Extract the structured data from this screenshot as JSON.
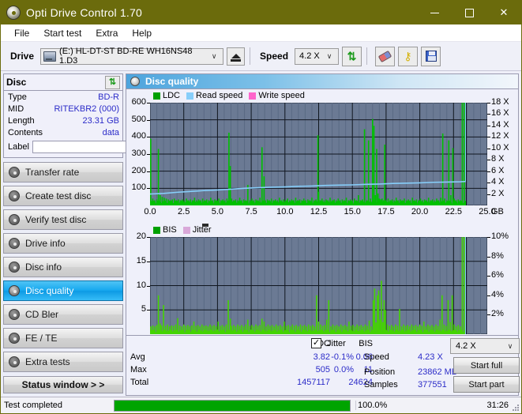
{
  "window": {
    "title": "Opti Drive Control 1.70",
    "icon": "disc-icon",
    "titlebar_color": "#6b6b0c",
    "minimize_label": "–",
    "maximize_label": "□",
    "close_label": "✕"
  },
  "menu": {
    "items": [
      "File",
      "Start test",
      "Extra",
      "Help"
    ]
  },
  "toolbar": {
    "drive_label": "Drive",
    "drive_value": "(E:)  HL-DT-ST BD-RE  WH16NS48 1.D3",
    "eject_icon": "eject-icon",
    "speed_label": "Speed",
    "speed_value": "4.2 X",
    "refresh_icon": "refresh-icon",
    "erase_icon": "eraser-icon",
    "key_icon": "key-icon",
    "save_icon": "save-icon",
    "dropdown_arrow": "∨"
  },
  "sidebar": {
    "disc_panel": {
      "title": "Disc",
      "refresh_icon": "refresh-icon",
      "rows": [
        {
          "key": "Type",
          "value": "BD-R"
        },
        {
          "key": "MID",
          "value": "RITEKBR2 (000)"
        },
        {
          "key": "Length",
          "value": "23.31 GB"
        },
        {
          "key": "Contents",
          "value": "data"
        }
      ],
      "label_key": "Label",
      "label_value": "",
      "label_placeholder": "",
      "disc_button_icon": "disc-icon"
    },
    "nav": [
      {
        "label": "Transfer rate",
        "active": false
      },
      {
        "label": "Create test disc",
        "active": false
      },
      {
        "label": "Verify test disc",
        "active": false
      },
      {
        "label": "Drive info",
        "active": false
      },
      {
        "label": "Disc info",
        "active": false
      },
      {
        "label": "Disc quality",
        "active": true
      },
      {
        "label": "CD Bler",
        "active": false
      },
      {
        "label": "FE / TE",
        "active": false
      },
      {
        "label": "Extra tests",
        "active": false
      }
    ],
    "status_window_label": "Status window > >"
  },
  "main": {
    "header_title": "Disc quality",
    "header_icon": "disc-quality-icon"
  },
  "stats": {
    "col_ldc": "LDC",
    "col_bis": "BIS",
    "row_avg": "Avg",
    "row_max": "Max",
    "row_total": "Total",
    "ldc_avg": "3.82",
    "ldc_max": "505",
    "ldc_total": "1457117",
    "bis_avg": "0.06",
    "bis_max": "11",
    "bis_total": "24624",
    "jitter_label": "Jitter",
    "jitter_checked": "✓",
    "jitter_avg": "-0.1%",
    "jitter_max": "0.0%",
    "speed_label": "Speed",
    "speed_value": "4.23 X",
    "position_label": "Position",
    "position_value": "23862 MB",
    "samples_label": "Samples",
    "samples_value": "377551",
    "speed_select": "4.2 X",
    "start_full_label": "Start full",
    "start_part_label": "Start part"
  },
  "statusbar": {
    "message": "Test completed",
    "progress_percent": "100.0%",
    "progress_value": 100,
    "elapsed": "31:26"
  },
  "chart_data": [
    {
      "id": "ldc-chart",
      "type": "line",
      "title": "",
      "xlabel": "GB",
      "ylabel": "",
      "xlim": [
        0,
        25
      ],
      "ylim": [
        0,
        600
      ],
      "y2lim": [
        0,
        18
      ],
      "grid": true,
      "legend_position": "top-left",
      "legend": [
        {
          "name": "LDC",
          "color": "#00a000"
        },
        {
          "name": "Read speed",
          "color": "#87cefa"
        },
        {
          "name": "Write speed",
          "color": "#ff66cc"
        }
      ],
      "xticks": [
        "0.0",
        "2.5",
        "5.0",
        "7.5",
        "10.0",
        "12.5",
        "15.0",
        "17.5",
        "20.0",
        "22.5",
        "25.0"
      ],
      "yticks": [
        100,
        200,
        300,
        400,
        500,
        600
      ],
      "y2ticks": [
        "2 X",
        "4 X",
        "6 X",
        "8 X",
        "10 X",
        "12 X",
        "14 X",
        "16 X",
        "18 X"
      ],
      "series": [
        {
          "name": "LDC",
          "color": "#00c000",
          "kind": "impulse",
          "x": [
            0.05,
            0.2,
            0.35,
            0.5,
            0.62,
            0.75,
            0.9,
            1.05,
            1.2,
            1.35,
            1.5,
            1.65,
            1.8,
            1.95,
            2.1,
            2.25,
            2.4,
            2.55,
            2.7,
            2.85,
            3.0,
            3.15,
            3.3,
            3.45,
            3.6,
            3.75,
            3.9,
            4.05,
            4.2,
            4.35,
            4.5,
            4.65,
            4.8,
            4.95,
            5.1,
            5.25,
            5.4,
            5.55,
            5.7,
            5.85,
            5.95,
            6.05,
            6.2,
            6.35,
            6.5,
            6.65,
            6.8,
            6.95,
            7.1,
            7.25,
            7.4,
            7.55,
            7.7,
            7.85,
            8.0,
            8.15,
            8.3,
            8.45,
            8.55,
            8.7,
            8.85,
            9.0,
            9.15,
            9.3,
            9.45,
            9.6,
            9.75,
            9.9,
            10.05,
            10.2,
            10.35,
            10.5,
            10.65,
            10.8,
            10.95,
            11.1,
            11.25,
            11.4,
            11.55,
            11.7,
            11.85,
            12.0,
            12.15,
            12.3,
            12.45,
            12.5,
            12.6,
            12.75,
            12.9,
            13.05,
            13.2,
            13.35,
            13.5,
            13.65,
            13.8,
            13.95,
            14.1,
            14.25,
            14.4,
            14.55,
            14.7,
            14.85,
            15.0,
            15.15,
            15.3,
            15.45,
            15.6,
            15.75,
            15.9,
            16.05,
            16.2,
            16.35,
            16.5,
            16.6,
            16.7,
            16.8,
            16.9,
            17.0,
            17.1,
            17.2,
            17.3,
            17.4,
            17.5,
            17.65,
            17.8,
            17.95,
            18.1,
            18.25,
            18.4,
            18.55,
            18.7,
            18.85,
            19.0,
            19.15,
            19.3,
            19.45,
            19.6,
            19.75,
            19.9,
            20.05,
            20.2,
            20.35,
            20.5,
            20.65,
            20.8,
            20.95,
            21.1,
            21.25,
            21.4,
            21.55,
            21.7,
            21.85,
            22.0,
            22.15,
            22.3,
            22.45,
            22.55,
            22.7,
            22.85,
            23.0,
            23.15,
            23.3
          ],
          "y": [
            390,
            40,
            30,
            35,
            330,
            60,
            50,
            45,
            40,
            35,
            30,
            35,
            40,
            30,
            35,
            30,
            35,
            30,
            40,
            30,
            35,
            30,
            45,
            30,
            35,
            30,
            40,
            30,
            35,
            30,
            45,
            30,
            35,
            30,
            40,
            30,
            35,
            30,
            40,
            425,
            230,
            40,
            30,
            35,
            30,
            45,
            30,
            35,
            30,
            120,
            30,
            40,
            30,
            35,
            30,
            45,
            340,
            170,
            30,
            35,
            30,
            40,
            30,
            35,
            30,
            45,
            30,
            35,
            30,
            40,
            30,
            35,
            30,
            45,
            30,
            35,
            30,
            40,
            30,
            35,
            30,
            45,
            30,
            35,
            410,
            80,
            30,
            40,
            30,
            35,
            30,
            45,
            30,
            35,
            30,
            40,
            30,
            35,
            30,
            45,
            30,
            35,
            30,
            40,
            30,
            60,
            30,
            35,
            445,
            30,
            380,
            40,
            505,
            465,
            60,
            330,
            70,
            40,
            35,
            40,
            30,
            355,
            30,
            40,
            30,
            35,
            30,
            45,
            30,
            35,
            30,
            40,
            30,
            35,
            30,
            45,
            30,
            35,
            30,
            40,
            30,
            35,
            30,
            45,
            30,
            35,
            30,
            40,
            30,
            45,
            420,
            40,
            30,
            380,
            60,
            335,
            40,
            30,
            35,
            30
          ]
        },
        {
          "name": "Read speed",
          "color": "#87cefa",
          "kind": "line",
          "x": [
            0.0,
            1.0,
            2.0,
            3.0,
            4.0,
            5.0,
            6.0,
            7.0,
            8.0,
            9.0,
            10.0,
            11.0,
            12.0,
            13.0,
            14.0,
            15.0,
            16.0,
            17.0,
            18.0,
            19.0,
            20.0,
            21.0,
            22.0,
            23.0,
            23.4,
            23.4,
            23.4
          ],
          "y": [
            2.0,
            2.1,
            2.3,
            2.45,
            2.6,
            2.7,
            2.85,
            3.0,
            3.1,
            3.2,
            3.25,
            3.35,
            3.4,
            3.5,
            3.55,
            3.6,
            3.7,
            3.75,
            3.85,
            3.9,
            3.95,
            4.05,
            4.1,
            4.15,
            4.2,
            10.5,
            18.0
          ],
          "axis": "y2"
        }
      ]
    },
    {
      "id": "bis-jitter-chart",
      "type": "line",
      "title": "",
      "xlabel": "GB",
      "ylabel": "",
      "xlim": [
        0,
        25
      ],
      "ylim": [
        0,
        20
      ],
      "y2lim": [
        0,
        10
      ],
      "grid": true,
      "legend_position": "top-left",
      "legend": [
        {
          "name": "BIS",
          "color": "#00a000"
        },
        {
          "name": "Jitter",
          "color": "#d9a8d9"
        }
      ],
      "xticks": [
        "0.0",
        "2.5",
        "5.0",
        "7.5",
        "10.0",
        "12.5",
        "15.0",
        "17.5",
        "20.0",
        "22.5",
        "25.0"
      ],
      "yticks": [
        5,
        10,
        15,
        20
      ],
      "y2ticks": [
        "2%",
        "4%",
        "6%",
        "8%",
        "10%"
      ],
      "series": [
        {
          "name": "BIS",
          "color": "#44d400",
          "kind": "impulse",
          "x": [
            0.05,
            0.2,
            0.35,
            0.5,
            0.62,
            0.75,
            0.85,
            1.0,
            1.15,
            1.3,
            1.45,
            1.6,
            1.75,
            1.9,
            2.05,
            2.2,
            2.35,
            2.5,
            2.65,
            2.8,
            2.95,
            3.1,
            3.25,
            3.4,
            3.55,
            3.7,
            3.85,
            4.0,
            4.15,
            4.3,
            4.45,
            4.6,
            4.75,
            4.9,
            5.05,
            5.2,
            5.35,
            5.5,
            5.65,
            5.8,
            5.95,
            6.05,
            6.2,
            6.35,
            6.5,
            6.65,
            6.8,
            6.95,
            7.1,
            7.25,
            7.4,
            7.55,
            7.7,
            7.85,
            8.0,
            8.15,
            8.3,
            8.45,
            8.6,
            8.75,
            8.9,
            9.05,
            9.2,
            9.35,
            9.5,
            9.65,
            9.8,
            9.95,
            10.1,
            10.25,
            10.4,
            10.55,
            10.7,
            10.85,
            11.0,
            11.15,
            11.3,
            11.45,
            11.6,
            11.75,
            11.9,
            12.05,
            12.2,
            12.35,
            12.5,
            12.65,
            12.8,
            12.95,
            13.1,
            13.25,
            13.4,
            13.55,
            13.7,
            13.85,
            14.0,
            14.15,
            14.3,
            14.45,
            14.6,
            14.75,
            14.9,
            15.05,
            15.2,
            15.35,
            15.5,
            15.65,
            15.8,
            15.95,
            16.1,
            16.25,
            16.4,
            16.55,
            16.65,
            16.75,
            16.85,
            16.95,
            17.05,
            17.15,
            17.25,
            17.35,
            17.45,
            17.6,
            17.75,
            17.9,
            18.05,
            18.2,
            18.35,
            18.5,
            18.65,
            18.8,
            18.95,
            19.1,
            19.25,
            19.4,
            19.55,
            19.7,
            19.85,
            20.0,
            20.15,
            20.3,
            20.45,
            20.6,
            20.75,
            20.9,
            21.05,
            21.2,
            21.35,
            21.5,
            21.65,
            21.8,
            21.95,
            22.1,
            22.25,
            22.4,
            22.55,
            22.7,
            22.85,
            23.0,
            23.15,
            23.3
          ],
          "y": [
            1.6,
            1.8,
            1.6,
            1.9,
            8.0,
            2.2,
            1.8,
            6.0,
            1.7,
            2.0,
            1.6,
            1.8,
            1.7,
            2.0,
            3.3,
            1.8,
            1.6,
            2.0,
            1.7,
            1.9,
            1.6,
            1.8,
            2.6,
            1.7,
            1.9,
            1.6,
            2.0,
            1.7,
            1.8,
            1.6,
            2.0,
            1.7,
            1.9,
            1.6,
            2.6,
            1.7,
            1.9,
            1.6,
            2.0,
            7.0,
            3.2,
            1.7,
            1.9,
            1.6,
            2.0,
            1.7,
            1.9,
            1.6,
            2.0,
            3.0,
            1.7,
            1.9,
            1.6,
            2.0,
            1.7,
            1.9,
            3.2,
            2.6,
            1.6,
            2.0,
            1.7,
            1.9,
            1.6,
            2.0,
            1.7,
            1.9,
            1.6,
            2.6,
            1.7,
            1.9,
            1.6,
            2.0,
            1.7,
            1.9,
            1.6,
            2.0,
            1.7,
            1.9,
            1.6,
            2.0,
            1.7,
            1.9,
            1.6,
            8.0,
            2.6,
            2.0,
            1.7,
            1.9,
            3.0,
            7.0,
            1.6,
            2.0,
            1.7,
            1.9,
            1.6,
            2.0,
            1.7,
            1.9,
            1.6,
            2.6,
            1.7,
            1.9,
            1.6,
            2.0,
            1.7,
            1.9,
            1.6,
            2.0,
            1.7,
            2.8,
            1.6,
            7.0,
            9.4,
            2.4,
            8.0,
            9.0,
            3.0,
            11.0,
            2.5,
            7.0,
            5.0,
            2.0,
            1.7,
            1.9,
            1.6,
            2.0,
            1.7,
            5.2,
            1.6,
            2.0,
            1.7,
            1.9,
            1.6,
            2.0,
            1.7,
            1.9,
            1.6,
            2.0,
            1.7,
            2.6,
            1.6,
            2.0,
            1.7,
            1.9,
            1.6,
            2.0,
            1.7,
            3.0,
            8.0,
            2.0,
            1.7,
            7.0,
            2.5,
            8.0,
            2.0,
            1.6,
            1.9,
            1.6
          ]
        },
        {
          "name": "Jitter",
          "color": "#d9a8d9",
          "kind": "line",
          "x": [],
          "y": [],
          "axis": "y2"
        },
        {
          "name": "speed-marker",
          "color": "#87cefa",
          "kind": "vline",
          "x": [
            23.4
          ],
          "y": [
            20
          ]
        }
      ]
    }
  ]
}
